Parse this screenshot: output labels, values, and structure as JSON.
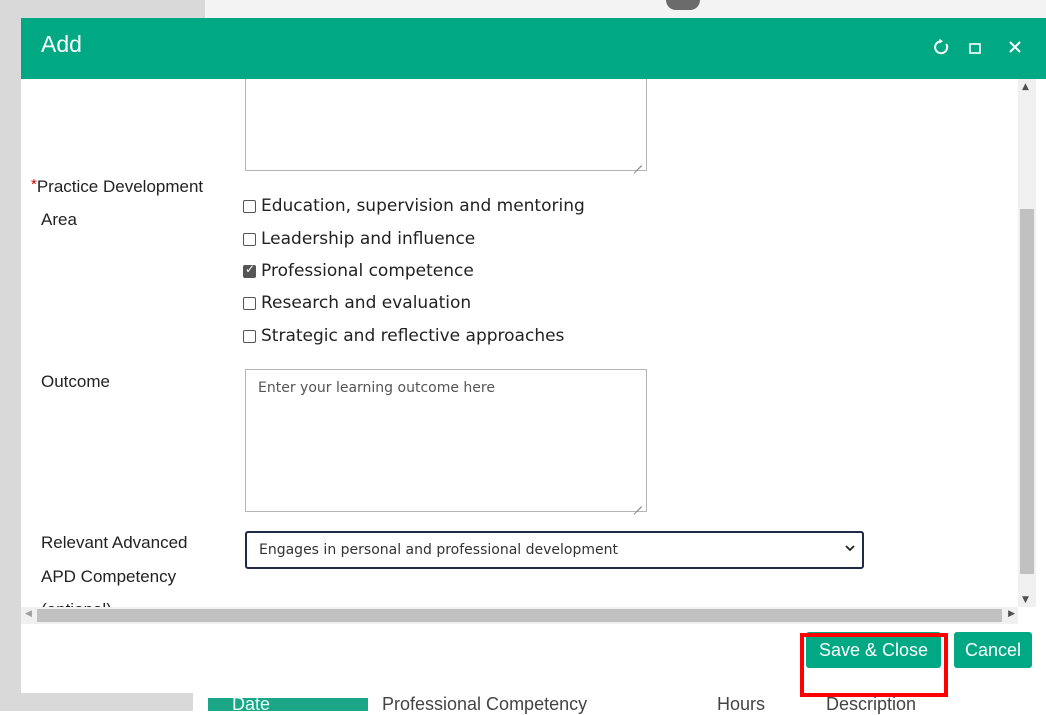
{
  "background": {
    "columns": [
      "Date",
      "Professional Competency",
      "Hours",
      "Description"
    ]
  },
  "modal": {
    "title": "Add",
    "header_icons": [
      "refresh-icon",
      "maximize-icon",
      "close-icon"
    ]
  },
  "form": {
    "practice_area": {
      "label_line1": "Practice Development",
      "label_line2": "Area",
      "required_mark": "*",
      "options": [
        {
          "label": "Education, supervision and mentoring",
          "checked": false
        },
        {
          "label": "Leadership and influence",
          "checked": false
        },
        {
          "label": "Professional competence",
          "checked": true
        },
        {
          "label": "Research and evaluation",
          "checked": false
        },
        {
          "label": "Strategic and reflective approaches",
          "checked": false
        }
      ]
    },
    "outcome": {
      "label": "Outcome",
      "placeholder": "Enter your learning outcome here"
    },
    "competency": {
      "label_line1": "Relevant Advanced",
      "label_line2": "APD Competency",
      "label_line3": "(optional)",
      "selected": "Engages in personal and professional development"
    }
  },
  "buttons": {
    "save_close": "Save & Close",
    "cancel": "Cancel"
  },
  "colors": {
    "brand": "#00a884",
    "highlight": "#ff0000",
    "required": "#d10000"
  }
}
